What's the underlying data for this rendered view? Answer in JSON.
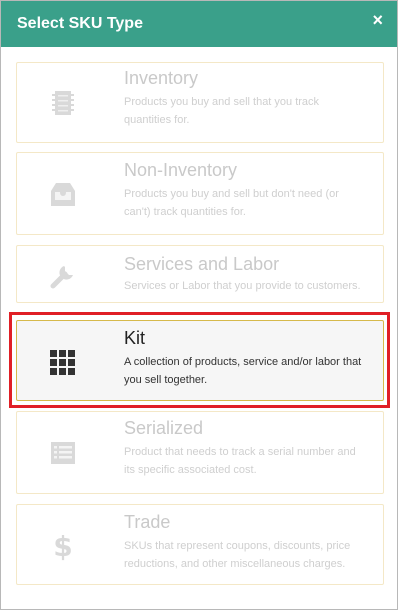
{
  "dialog": {
    "title": "Select SKU Type",
    "close_icon": "×"
  },
  "sku_types": [
    {
      "name": "Inventory",
      "description": "Products you buy and sell that you track quantities for.",
      "icon": "barcode-icon"
    },
    {
      "name": "Non-Inventory",
      "description": "Products you buy and sell but don't need (or can't) track quantities for.",
      "icon": "inbox-tray-icon"
    },
    {
      "name": "Services and Labor",
      "description": "Services or Labor that you provide to customers.",
      "icon": "wrench-icon"
    },
    {
      "name": "Kit",
      "description": "A collection of products, service and/or labor that you sell together.",
      "icon": "grid-icon"
    },
    {
      "name": "Serialized",
      "description": "Product that needs to track a serial number and its specific associated cost.",
      "icon": "list-icon"
    },
    {
      "name": "Trade",
      "description": "SKUs that represent coupons, discounts, price reductions, and other miscellaneous charges.",
      "icon": "dollar-icon"
    }
  ],
  "colors": {
    "header": "#3aa08a",
    "highlight": "#e01f26",
    "card_border": "#f4e8c7",
    "active_border": "#d6b94b"
  }
}
